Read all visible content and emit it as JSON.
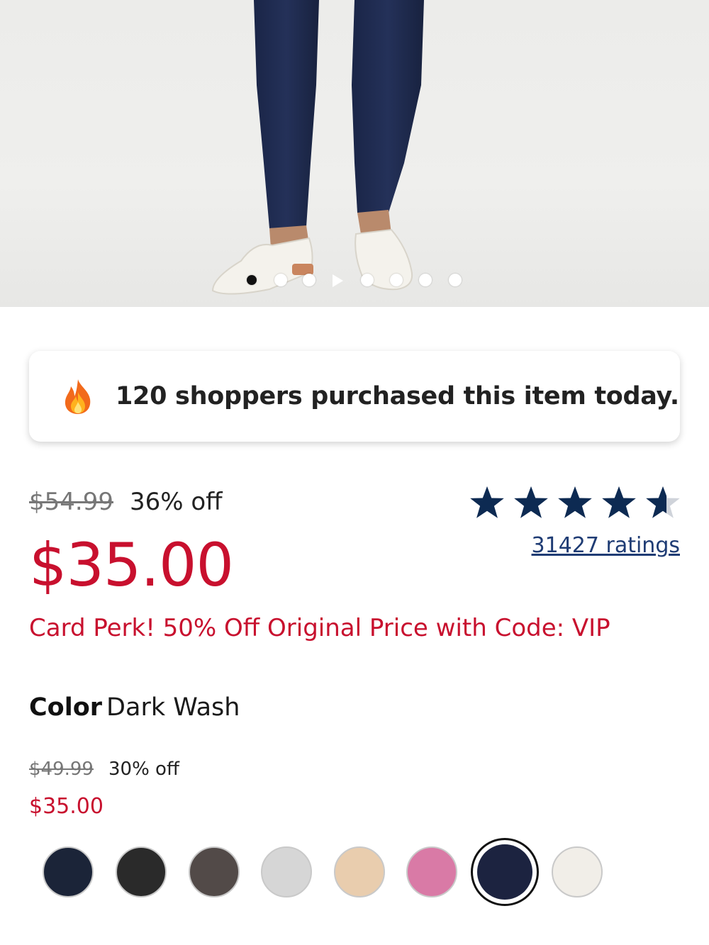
{
  "carousel": {
    "slide_count": 8,
    "active_index": 0,
    "video_index": 3
  },
  "social_proof": {
    "icon": "fire-icon",
    "text": "120 shoppers purchased this item today."
  },
  "pricing": {
    "original_price": "$54.99",
    "percent_off": "36% off",
    "sale_price": "$35.00",
    "rating": 4.6,
    "rating_max": 5,
    "ratings_link": "31427 ratings",
    "perk": "Card Perk! 50% Off Original Price with Code: VIP"
  },
  "color": {
    "label": "Color",
    "value": "Dark Wash",
    "variant_original_price": "$49.99",
    "variant_percent_off": "30% off",
    "variant_price": "$35.00",
    "swatches": [
      {
        "color": "#1b2438"
      },
      {
        "color": "#2a2a2a"
      },
      {
        "color": "#524a48"
      },
      {
        "color": "#d6d6d6"
      },
      {
        "color": "#e9cdae"
      },
      {
        "color": "#d97aa6"
      },
      {
        "color": "#1c2340",
        "selected": true
      },
      {
        "color": "#f1eee8"
      }
    ]
  },
  "colors": {
    "sale_red": "#c8102e",
    "link_blue": "#1f3c74",
    "star_navy": "#0d2a52"
  }
}
